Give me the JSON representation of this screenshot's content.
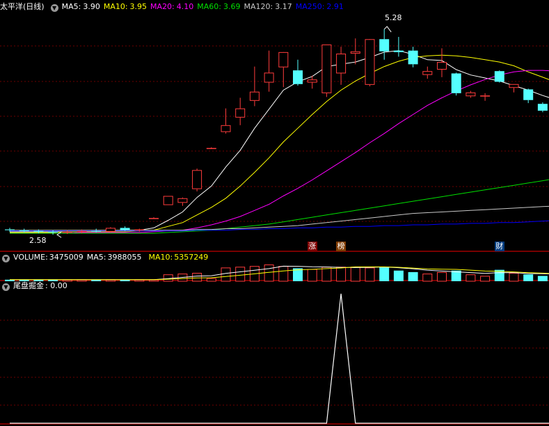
{
  "app": {
    "stock_name": "太平洋",
    "period": "(日线)"
  },
  "colors": {
    "background": "#000000",
    "up_candle": "#ff3c3c",
    "down_candle": "#54ffff",
    "grid": "#6e0000",
    "divider": "#a00000",
    "ma5": "#ffffff",
    "ma10": "#ffff00",
    "ma20": "#ff00ff",
    "ma60": "#00e000",
    "ma120": "#c8c8c8",
    "ma250": "#0000ff",
    "indicator_line": "#ffffff",
    "tag_zhang_bg": "#800000",
    "tag_bang_bg": "#803c00",
    "tag_cai_bg": "#003c80"
  },
  "price_panel": {
    "legend": [
      {
        "label": "MA5:",
        "value": "3.90",
        "color": "#ffffff"
      },
      {
        "label": "MA10:",
        "value": "3.95",
        "color": "#ffff00"
      },
      {
        "label": "MA20:",
        "value": "4.10",
        "color": "#ff00ff"
      },
      {
        "label": "MA60:",
        "value": "3.69",
        "color": "#00e000"
      },
      {
        "label": "MA120:",
        "value": "3.17",
        "color": "#c8c8c8"
      },
      {
        "label": "MA250:",
        "value": "2.91",
        "color": "#0000ff"
      }
    ],
    "high_label": "5.28",
    "low_label": "2.58",
    "event_tags": [
      {
        "text": "涨",
        "index": 21
      },
      {
        "text": "榜",
        "index": 23
      },
      {
        "text": "财",
        "index": 34
      }
    ]
  },
  "volume_panel": {
    "title": "VOLUME:",
    "value": "3475009",
    "ma5_label": "MA5:",
    "ma5_value": "3988055",
    "ma10_label": "MA10:",
    "ma10_value": "5357249"
  },
  "indicator_panel": {
    "title": "尾盘掘金",
    "value": ": 0.00"
  },
  "chart_data": {
    "type": "candlestick",
    "ylim": [
      2.5,
      5.5
    ],
    "candles": [
      {
        "o": 2.65,
        "h": 2.67,
        "l": 2.62,
        "c": 2.64
      },
      {
        "o": 2.64,
        "h": 2.66,
        "l": 2.61,
        "c": 2.63
      },
      {
        "o": 2.63,
        "h": 2.65,
        "l": 2.6,
        "c": 2.62
      },
      {
        "o": 2.62,
        "h": 2.64,
        "l": 2.58,
        "c": 2.61
      },
      {
        "o": 2.61,
        "h": 2.64,
        "l": 2.59,
        "c": 2.62
      },
      {
        "o": 2.62,
        "h": 2.65,
        "l": 2.6,
        "c": 2.63
      },
      {
        "o": 2.63,
        "h": 2.66,
        "l": 2.61,
        "c": 2.62
      },
      {
        "o": 2.62,
        "h": 2.68,
        "l": 2.61,
        "c": 2.67
      },
      {
        "o": 2.67,
        "h": 2.69,
        "l": 2.63,
        "c": 2.64
      },
      {
        "o": 2.64,
        "h": 2.66,
        "l": 2.62,
        "c": 2.65
      },
      {
        "o": 2.8,
        "h": 2.81,
        "l": 2.79,
        "c": 2.8
      },
      {
        "o": 2.97,
        "h": 3.09,
        "l": 2.97,
        "c": 3.09
      },
      {
        "o": 3.0,
        "h": 3.07,
        "l": 2.96,
        "c": 3.06
      },
      {
        "o": 3.18,
        "h": 3.45,
        "l": 3.15,
        "c": 3.43
      },
      {
        "o": 3.72,
        "h": 3.73,
        "l": 3.71,
        "c": 3.72
      },
      {
        "o": 3.93,
        "h": 4.24,
        "l": 3.91,
        "c": 4.02
      },
      {
        "o": 4.12,
        "h": 4.38,
        "l": 4.02,
        "c": 4.24
      },
      {
        "o": 4.34,
        "h": 4.79,
        "l": 4.27,
        "c": 4.46
      },
      {
        "o": 4.58,
        "h": 5.0,
        "l": 4.46,
        "c": 4.71
      },
      {
        "o": 4.78,
        "h": 4.97,
        "l": 4.52,
        "c": 4.98
      },
      {
        "o": 4.74,
        "h": 4.88,
        "l": 4.54,
        "c": 4.56
      },
      {
        "o": 4.58,
        "h": 4.67,
        "l": 4.5,
        "c": 4.62
      },
      {
        "o": 4.44,
        "h": 5.08,
        "l": 4.39,
        "c": 5.08
      },
      {
        "o": 4.7,
        "h": 5.05,
        "l": 4.55,
        "c": 4.96
      },
      {
        "o": 4.96,
        "h": 5.16,
        "l": 4.82,
        "c": 4.99
      },
      {
        "o": 4.55,
        "h": 5.0,
        "l": 4.53,
        "c": 5.15
      },
      {
        "o": 5.15,
        "h": 5.28,
        "l": 4.88,
        "c": 4.99
      },
      {
        "o": 5.0,
        "h": 5.18,
        "l": 4.92,
        "c": 4.98
      },
      {
        "o": 5.0,
        "h": 5.05,
        "l": 4.78,
        "c": 4.82
      },
      {
        "o": 4.68,
        "h": 4.79,
        "l": 4.63,
        "c": 4.73
      },
      {
        "o": 4.75,
        "h": 5.03,
        "l": 4.65,
        "c": 4.85
      },
      {
        "o": 4.7,
        "h": 4.71,
        "l": 4.41,
        "c": 4.44
      },
      {
        "o": 4.4,
        "h": 4.47,
        "l": 4.38,
        "c": 4.45
      },
      {
        "o": 4.4,
        "h": 4.44,
        "l": 4.34,
        "c": 4.41
      },
      {
        "o": 4.73,
        "h": 4.74,
        "l": 4.58,
        "c": 4.59
      },
      {
        "o": 4.51,
        "h": 4.56,
        "l": 4.45,
        "c": 4.56
      },
      {
        "o": 4.49,
        "h": 4.5,
        "l": 4.31,
        "c": 4.35
      },
      {
        "o": 4.3,
        "h": 4.32,
        "l": 4.19,
        "c": 4.21
      },
      {
        "o": 4.19,
        "h": 4.23,
        "l": 4.08,
        "c": 4.08
      }
    ],
    "volume": [
      2,
      2,
      2,
      2,
      2,
      2,
      2,
      2,
      2,
      2,
      2,
      9,
      10,
      11,
      4,
      18,
      19,
      20,
      22,
      20,
      17,
      16,
      19,
      19,
      19,
      18,
      19,
      14,
      12,
      10,
      12,
      14,
      9,
      7,
      15,
      11,
      9,
      7,
      6
    ],
    "volume_ylim": [
      0,
      22
    ],
    "ma_series": [
      {
        "name": "MA5",
        "color": "#ffffff",
        "values": [
          2.62,
          2.62,
          2.62,
          2.62,
          2.62,
          2.62,
          2.63,
          2.63,
          2.64,
          2.64,
          2.67,
          2.77,
          2.88,
          3.07,
          3.22,
          3.47,
          3.69,
          3.98,
          4.23,
          4.48,
          4.59,
          4.66,
          4.79,
          4.82,
          4.85,
          4.91,
          4.98,
          5.0,
          4.95,
          4.88,
          4.87,
          4.75,
          4.68,
          4.64,
          4.6,
          4.54,
          4.48,
          4.41,
          4.35
        ]
      },
      {
        "name": "MA10",
        "color": "#ffff00",
        "values": [
          2.61,
          2.61,
          2.61,
          2.61,
          2.62,
          2.62,
          2.62,
          2.62,
          2.62,
          2.63,
          2.64,
          2.69,
          2.74,
          2.84,
          2.94,
          3.06,
          3.22,
          3.4,
          3.59,
          3.8,
          3.98,
          4.16,
          4.33,
          4.48,
          4.6,
          4.7,
          4.79,
          4.86,
          4.91,
          4.93,
          4.94,
          4.93,
          4.91,
          4.88,
          4.85,
          4.8,
          4.72,
          4.65,
          4.58
        ]
      },
      {
        "name": "MA20",
        "color": "#ff00ff",
        "values": [
          2.6,
          2.6,
          2.6,
          2.6,
          2.6,
          2.61,
          2.61,
          2.61,
          2.61,
          2.61,
          2.62,
          2.63,
          2.64,
          2.67,
          2.71,
          2.76,
          2.82,
          2.9,
          2.98,
          3.09,
          3.19,
          3.3,
          3.42,
          3.54,
          3.66,
          3.79,
          3.91,
          4.04,
          4.16,
          4.28,
          4.38,
          4.47,
          4.55,
          4.62,
          4.68,
          4.72,
          4.74,
          4.74,
          4.73
        ]
      },
      {
        "name": "MA60",
        "color": "#00e000",
        "values": [
          2.6,
          2.6,
          2.6,
          2.6,
          2.6,
          2.6,
          2.6,
          2.6,
          2.6,
          2.6,
          2.6,
          2.61,
          2.62,
          2.63,
          2.64,
          2.66,
          2.68,
          2.7,
          2.72,
          2.75,
          2.78,
          2.81,
          2.84,
          2.87,
          2.9,
          2.93,
          2.96,
          2.99,
          3.02,
          3.05,
          3.08,
          3.11,
          3.14,
          3.17,
          3.2,
          3.23,
          3.26,
          3.29,
          3.32
        ]
      },
      {
        "name": "MA120",
        "color": "#c8c8c8",
        "values": [
          2.64,
          2.64,
          2.64,
          2.64,
          2.64,
          2.64,
          2.64,
          2.64,
          2.64,
          2.64,
          2.64,
          2.64,
          2.64,
          2.65,
          2.65,
          2.66,
          2.66,
          2.67,
          2.68,
          2.69,
          2.7,
          2.72,
          2.74,
          2.76,
          2.78,
          2.8,
          2.82,
          2.84,
          2.86,
          2.87,
          2.88,
          2.89,
          2.9,
          2.91,
          2.92,
          2.93,
          2.94,
          2.95,
          2.96
        ]
      },
      {
        "name": "MA250",
        "color": "#0000ff",
        "values": [
          2.63,
          2.63,
          2.63,
          2.63,
          2.63,
          2.63,
          2.63,
          2.63,
          2.63,
          2.63,
          2.63,
          2.63,
          2.63,
          2.64,
          2.64,
          2.64,
          2.65,
          2.65,
          2.66,
          2.66,
          2.67,
          2.67,
          2.68,
          2.68,
          2.69,
          2.69,
          2.7,
          2.7,
          2.71,
          2.71,
          2.72,
          2.72,
          2.73,
          2.73,
          2.74,
          2.74,
          2.75,
          2.76,
          2.77
        ]
      }
    ],
    "indicator": {
      "type": "line",
      "ylim": [
        0,
        1
      ],
      "values": [
        0,
        0,
        0,
        0,
        0,
        0,
        0,
        0,
        0,
        0,
        0,
        0,
        0,
        0,
        0,
        0,
        0,
        0,
        0,
        0,
        0,
        0,
        0,
        1,
        0,
        0,
        0,
        0,
        0,
        0,
        0,
        0,
        0,
        0,
        0,
        0,
        0,
        0,
        0
      ]
    }
  }
}
